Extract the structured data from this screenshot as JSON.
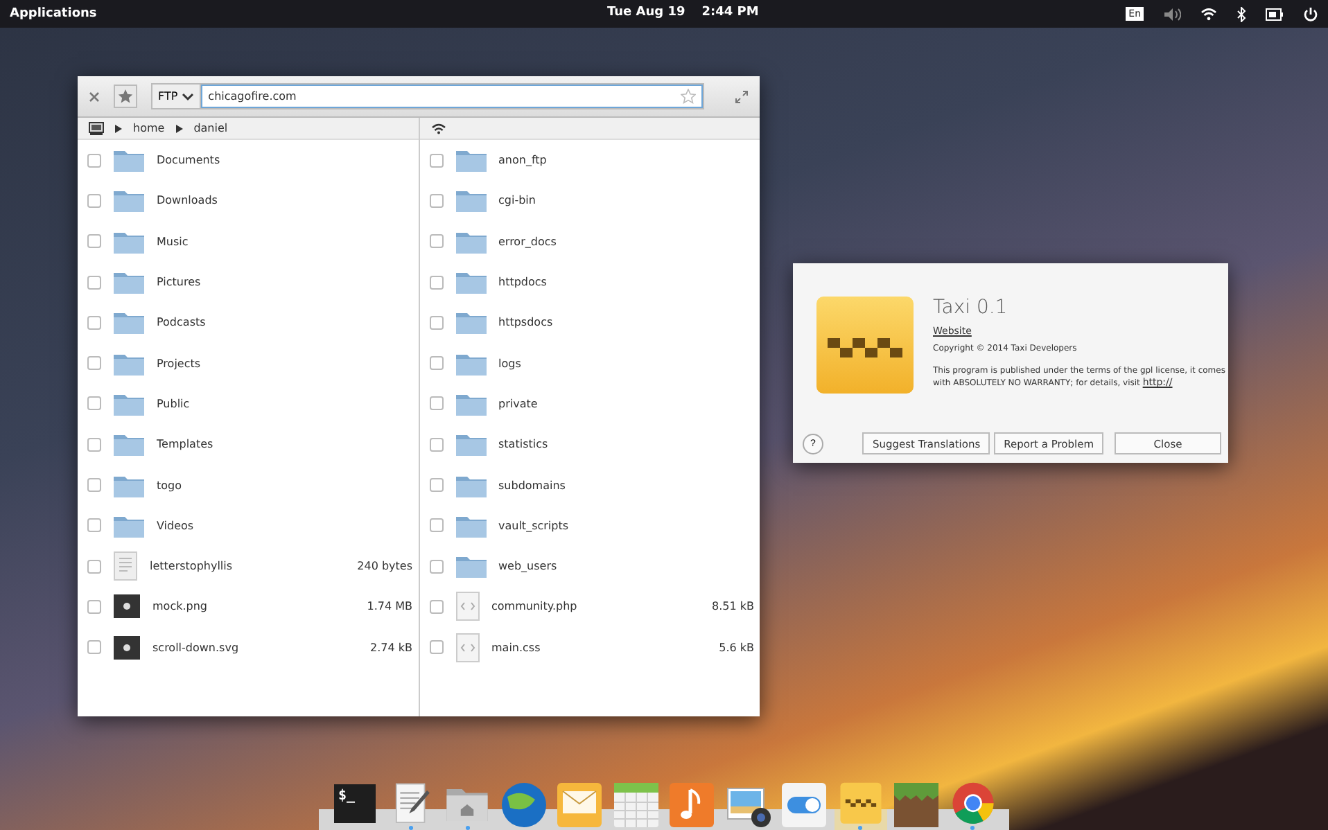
{
  "panel": {
    "applications": "Applications",
    "date": "Tue Aug 19",
    "time": "2:44 PM",
    "keyboard": "En"
  },
  "file_window": {
    "protocol": "FTP",
    "address": "chicagofire.com",
    "local_path": [
      "home",
      "daniel"
    ],
    "local_files": [
      {
        "name": "Documents",
        "kind": "folder",
        "checked": false
      },
      {
        "name": "Downloads",
        "kind": "folder",
        "checked": false
      },
      {
        "name": "Music",
        "kind": "folder",
        "checked": false
      },
      {
        "name": "Pictures",
        "kind": "folder",
        "checked": false
      },
      {
        "name": "Podcasts",
        "kind": "folder",
        "checked": false
      },
      {
        "name": "Projects",
        "kind": "folder",
        "checked": false
      },
      {
        "name": "Public",
        "kind": "folder",
        "checked": false
      },
      {
        "name": "Templates",
        "kind": "folder",
        "checked": false
      },
      {
        "name": "togo",
        "kind": "folder",
        "checked": false
      },
      {
        "name": "Videos",
        "kind": "folder",
        "checked": false
      },
      {
        "name": "letterstophyllis",
        "kind": "text",
        "size": "240 bytes",
        "checked": false
      },
      {
        "name": "mock.png",
        "kind": "image",
        "size": "1.74 MB",
        "checked": false
      },
      {
        "name": "scroll-down.svg",
        "kind": "image",
        "size": "2.74 kB",
        "checked": false
      }
    ],
    "remote_files": [
      {
        "name": "anon_ftp",
        "kind": "folder",
        "checked": false
      },
      {
        "name": "cgi-bin",
        "kind": "folder",
        "checked": false
      },
      {
        "name": "error_docs",
        "kind": "folder",
        "checked": false
      },
      {
        "name": "httpdocs",
        "kind": "folder",
        "checked": false
      },
      {
        "name": "httpsdocs",
        "kind": "folder",
        "checked": false
      },
      {
        "name": "logs",
        "kind": "folder",
        "checked": false
      },
      {
        "name": "private",
        "kind": "folder",
        "checked": false
      },
      {
        "name": "statistics",
        "kind": "folder",
        "checked": false
      },
      {
        "name": "subdomains",
        "kind": "folder",
        "checked": false
      },
      {
        "name": "vault_scripts",
        "kind": "folder",
        "checked": false
      },
      {
        "name": "web_users",
        "kind": "folder",
        "checked": false
      },
      {
        "name": "community.php",
        "kind": "code",
        "size": "8.51 kB",
        "checked": false
      },
      {
        "name": "main.css",
        "kind": "code",
        "size": "5.6 kB",
        "checked": false
      }
    ]
  },
  "about_dialog": {
    "title": "Taxi 0.1",
    "website": "Website",
    "copyright": "Copyright © 2014 Taxi Developers",
    "license": "This program is published under the terms of the gpl license, it comes with ABSOLUTELY NO WARRANTY; for details, visit ",
    "license_link": "http://",
    "help": "?",
    "buttons": [
      "Suggest Translations",
      "Report a Problem",
      "Close"
    ]
  },
  "dock": [
    {
      "kind": "terminal",
      "label": "$_",
      "running": false
    },
    {
      "kind": "editor",
      "running": true
    },
    {
      "kind": "files",
      "running": true
    },
    {
      "kind": "globe",
      "running": false
    },
    {
      "kind": "mail",
      "running": false
    },
    {
      "kind": "calendar",
      "running": false
    },
    {
      "kind": "music",
      "running": false
    },
    {
      "kind": "photos",
      "running": false
    },
    {
      "kind": "switch",
      "running": false
    },
    {
      "kind": "taxi",
      "running": true
    },
    {
      "kind": "grass",
      "running": false
    },
    {
      "kind": "browser",
      "running": true
    }
  ]
}
